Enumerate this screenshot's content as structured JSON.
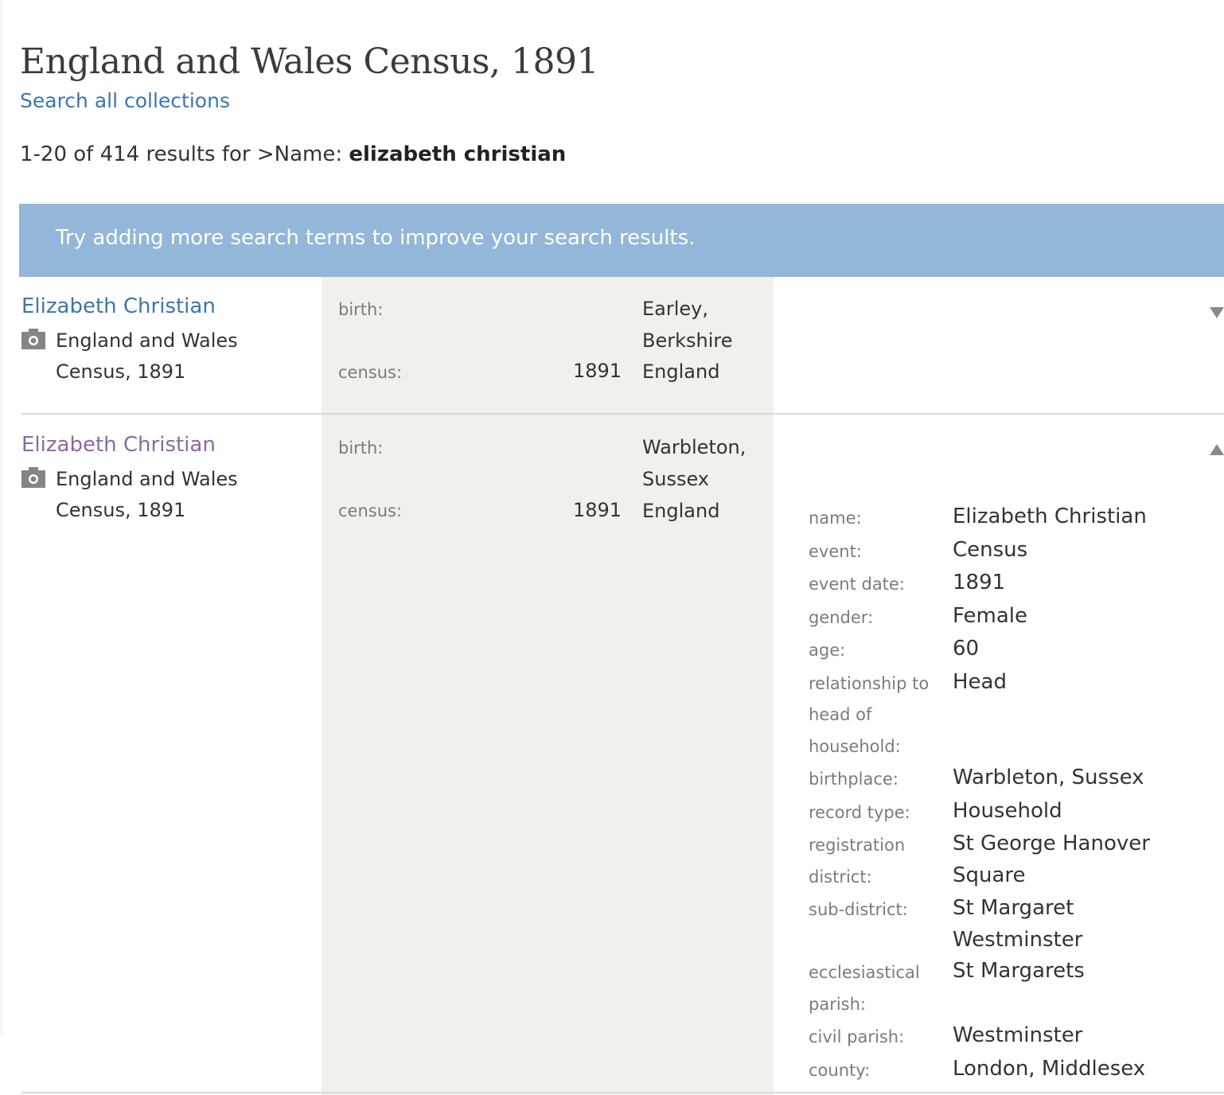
{
  "page": {
    "title": "England and Wales Census, 1891",
    "search_all_link": "Search all collections",
    "results_prefix": "1-20 of 414 results for >Name: ",
    "results_query": "elizabeth christian",
    "tip": "Try adding more search terms to improve your search results."
  },
  "colors": {
    "banner": "#93b7d9",
    "link": "#3a76b0",
    "visited_link": "#8a6aa3",
    "event_column": "#f0f0ec"
  },
  "results": [
    {
      "name": "Elizabeth Christian",
      "collection_icon": "camera-icon",
      "collection_line1": "England and Wales",
      "collection_line2": "Census, 1891",
      "birth_label": "birth:",
      "birth_place_line1": "Earley,",
      "birth_place_line2": "Berkshire",
      "census_label": "census:",
      "census_year": "1891",
      "census_place": "England",
      "toggle_icon": "chevron-down-icon",
      "expanded": false
    },
    {
      "name": "Elizabeth Christian",
      "collection_icon": "camera-icon",
      "collection_line1": "England and Wales",
      "collection_line2": "Census, 1891",
      "birth_label": "birth:",
      "birth_place_line1": "Warbleton,",
      "birth_place_line2": "Sussex",
      "census_label": "census:",
      "census_year": "1891",
      "census_place": "England",
      "toggle_icon": "chevron-up-icon",
      "expanded": true,
      "details": [
        {
          "label": "name:",
          "value": "Elizabeth Christian"
        },
        {
          "label": "event:",
          "value": "Census"
        },
        {
          "label": "event date:",
          "value": "1891"
        },
        {
          "label": "gender:",
          "value": "Female"
        },
        {
          "label": "age:",
          "value": "60"
        },
        {
          "label": "relationship to head of household:",
          "value": "Head"
        },
        {
          "label": "birthplace:",
          "value": "Warbleton, Sussex"
        },
        {
          "label": "record type:",
          "value": "Household"
        },
        {
          "label": "registration district:",
          "value": "St George Hanover Square"
        },
        {
          "label": "sub-district:",
          "value": "St Margaret Westminster"
        },
        {
          "label": "ecclesiastical parish:",
          "value": "St Margarets"
        },
        {
          "label": "civil parish:",
          "value": "Westminster"
        },
        {
          "label": "county:",
          "value": "London, Middlesex"
        }
      ]
    }
  ]
}
